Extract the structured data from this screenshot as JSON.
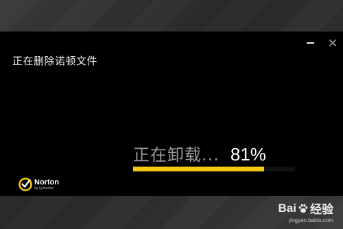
{
  "window": {
    "title": "正在删除诺顿文件",
    "minimize_icon": "minimize-icon",
    "close_icon": "close-icon",
    "background": "#000000"
  },
  "progress": {
    "status_text": "正在卸载...",
    "percent_label": "81%",
    "value": 0.81,
    "fill_color": "#f6c913"
  },
  "logo": {
    "name": "Norton",
    "sub": "by Symantec",
    "icon": "norton-check-icon",
    "accent": "#f6c913"
  },
  "watermark": {
    "brand_prefix": "Bai",
    "brand_suffix": "经验",
    "url": "jingyan.baidu.com",
    "icon": "baidu-paw-icon"
  }
}
